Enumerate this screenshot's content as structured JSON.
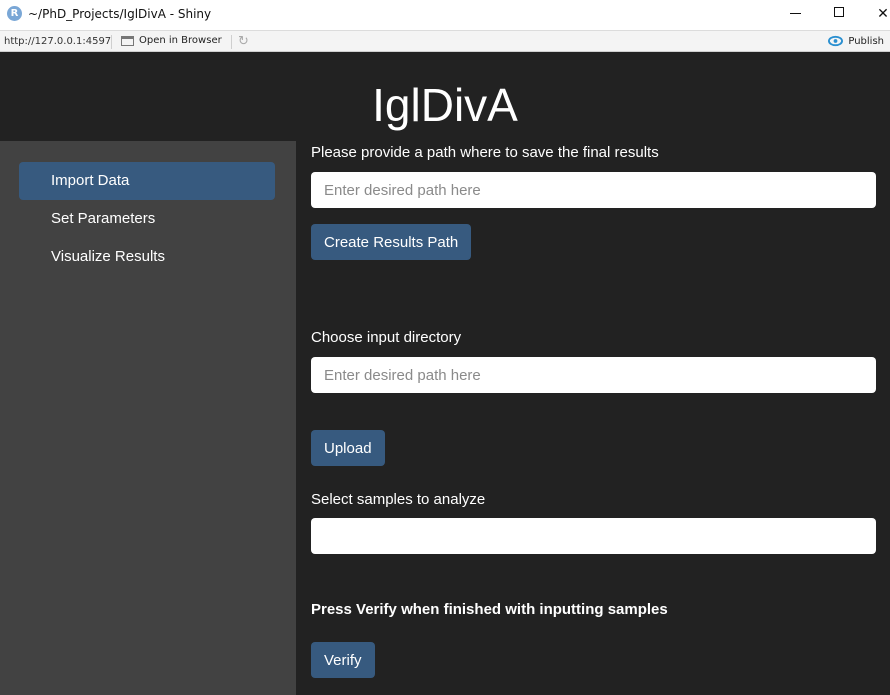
{
  "window": {
    "icon_letter": "R",
    "title": "~/PhD_Projects/IglDivA - Shiny"
  },
  "toolbar": {
    "url": "http://127.0.0.1:4597",
    "open_in_browser": "Open in Browser",
    "publish": "Publish"
  },
  "app": {
    "title": "IglDivA",
    "sidebar": {
      "items": [
        {
          "label": "Import Data",
          "active": true
        },
        {
          "label": "Set Parameters",
          "active": false
        },
        {
          "label": "Visualize Results",
          "active": false
        }
      ]
    },
    "main": {
      "results_path_label": "Please provide a path where to save the final results",
      "results_path_placeholder": "Enter desired path here",
      "create_results_button": "Create Results Path",
      "input_dir_label": "Choose input directory",
      "input_dir_placeholder": "Enter desired path here",
      "upload_button": "Upload",
      "samples_label": "Select samples to analyze",
      "samples_value": "",
      "verify_instruction": "Press Verify when finished with inputting samples",
      "verify_button": "Verify"
    }
  },
  "colors": {
    "background": "#222222",
    "sidebar": "#424242",
    "accent": "#375a7f"
  }
}
